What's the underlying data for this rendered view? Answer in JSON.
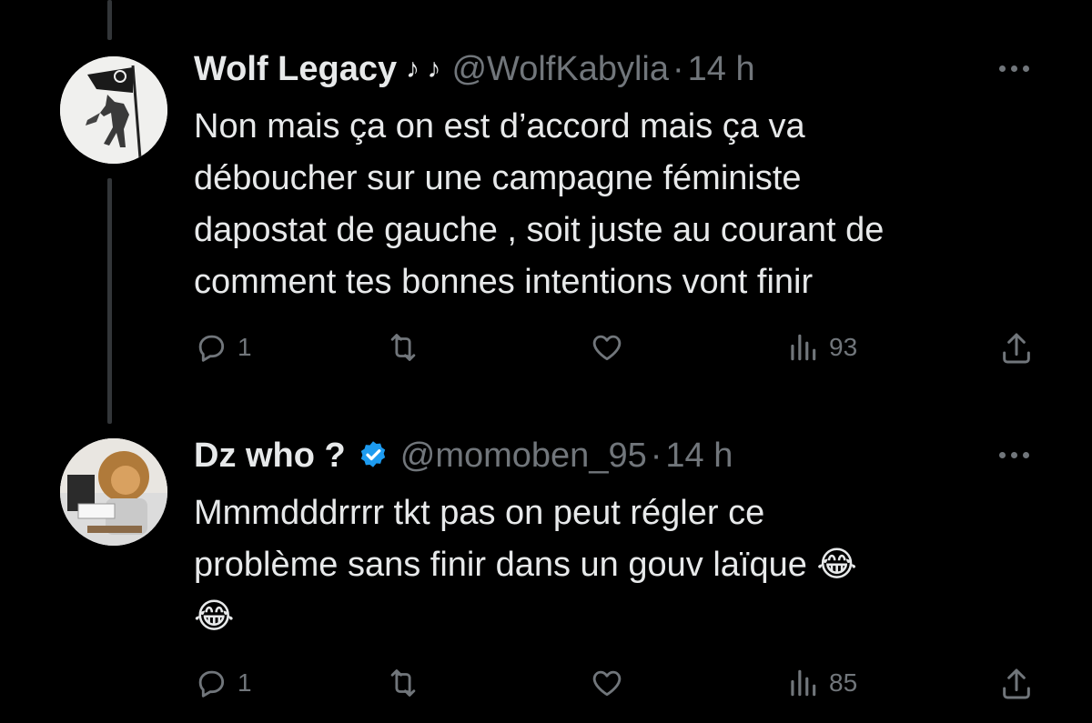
{
  "tweets": [
    {
      "name": "Wolf Legacy",
      "name_decoration": "♪ ♪",
      "handle": "@WolfKabylia",
      "separator": "·",
      "time": "14 h",
      "text": "Non mais ça on est d’accord mais ça va\ndéboucher sur une campagne féministe\ndapostat de gauche , soit juste au courant de\ncomment tes bonnes intentions vont finir",
      "verified": false,
      "avatar_icon": "wolf-flag-avatar",
      "stats": {
        "replies": "1",
        "retweets": "",
        "likes": "",
        "views": "93"
      }
    },
    {
      "name": "Dz who ?",
      "handle": "@momoben_95",
      "separator": "·",
      "time": "14 h",
      "text": "Mmmdddrrrr tkt pas on peut régler ce\nproblème sans finir dans un gouv laïque 😂\n😂",
      "verified": true,
      "avatar_icon": "lion-avatar",
      "stats": {
        "replies": "1",
        "retweets": "",
        "likes": "",
        "views": "85"
      }
    }
  ],
  "colors": {
    "background": "#000000",
    "text": "#e7e9ea",
    "muted": "#71767b",
    "verified": "#1d9bf0",
    "thread_line": "#333639"
  }
}
